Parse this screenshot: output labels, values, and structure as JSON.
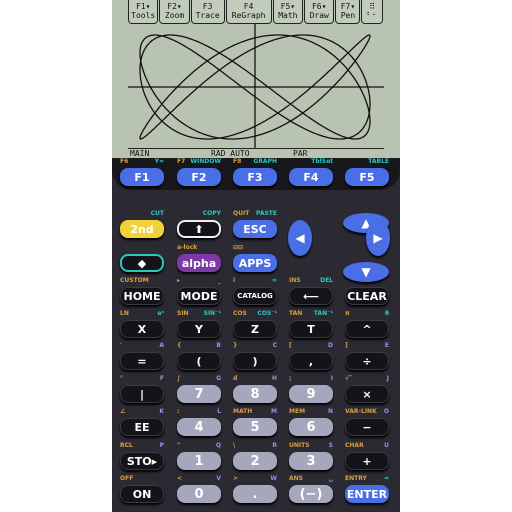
{
  "lcd": {
    "menu": [
      {
        "fn": "F1▾",
        "label": "Tools"
      },
      {
        "fn": "F2▾",
        "label": "Zoom"
      },
      {
        "fn": "F3",
        "label": "Trace"
      },
      {
        "fn": "F4",
        "label": "ReGraph"
      },
      {
        "fn": "F5▾",
        "label": "Math"
      },
      {
        "fn": "F6▾",
        "label": "Draw"
      },
      {
        "fn": "F7▾",
        "label": "Pen"
      },
      {
        "fn": "⠿",
        "label": "⠃⠂"
      }
    ],
    "status": {
      "folder": "MAIN",
      "mode": "RAD AUTO",
      "graph_mode": "PAR"
    }
  },
  "colors": {
    "second": "#d9a040",
    "diamond": "#2cc8c0",
    "alpha": "#a888e8",
    "lcd": "#b8c3b2",
    "body": "#2b2a33"
  },
  "keypad": {
    "fkeys": [
      {
        "label": "F1",
        "tl": "F6",
        "tr": "Y="
      },
      {
        "label": "F2",
        "tl": "F7",
        "tr": "WINDOW"
      },
      {
        "label": "F3",
        "tl": "F8",
        "tr": "GRAPH"
      },
      {
        "label": "F4",
        "tl": "",
        "tr": "TblSet"
      },
      {
        "label": "F5",
        "tl": "",
        "tr": "TABLE"
      }
    ],
    "rows": [
      [
        {
          "label": "2nd",
          "style": "yellow",
          "tl": "",
          "tr": "CUT"
        },
        {
          "label": "⬆",
          "style": "shift",
          "tl": "",
          "tr": "COPY"
        },
        {
          "label": "ESC",
          "style": "blue",
          "tl": "QUIT",
          "tr": "PASTE"
        }
      ],
      [
        {
          "label": "◆",
          "style": "diamond",
          "tl": "",
          "tr": ""
        },
        {
          "label": "alpha",
          "style": "purple",
          "tl": "a-lock",
          "tr": ""
        },
        {
          "label": "APPS",
          "style": "blue",
          "tl": "⊟⊟",
          "tr": ""
        }
      ],
      [
        {
          "label": "HOME",
          "style": "black",
          "tl": "CUSTOM",
          "tr": ""
        },
        {
          "label": "MODE",
          "style": "black",
          "tl": "▸",
          "tr": "_"
        },
        {
          "label": "CATALOG",
          "style": "black",
          "tl": "i",
          "tr": "∞"
        },
        {
          "label": "⟵",
          "style": "black",
          "tl": "INS",
          "tr": "DEL"
        },
        {
          "label": "CLEAR",
          "style": "black",
          "tl": "",
          "tr": ""
        }
      ],
      [
        {
          "label": "X",
          "style": "black",
          "tl": "LN",
          "tr": "eˣ"
        },
        {
          "label": "Y",
          "style": "black",
          "tl": "SIN",
          "tr": "SIN⁻¹"
        },
        {
          "label": "Z",
          "style": "black",
          "tl": "COS",
          "tr": "COS⁻¹"
        },
        {
          "label": "T",
          "style": "black",
          "tl": "TAN",
          "tr": "TAN⁻¹"
        },
        {
          "label": "^",
          "style": "black",
          "tl": "π",
          "tr": "θ"
        }
      ],
      [
        {
          "label": "=",
          "style": "black",
          "tl": "'",
          "tr": "A"
        },
        {
          "label": "(",
          "style": "black",
          "tl": "{",
          "tr": "B"
        },
        {
          "label": ")",
          "style": "black",
          "tl": "}",
          "tr": "C"
        },
        {
          "label": ",",
          "style": "black",
          "tl": "[",
          "tr": "D"
        },
        {
          "label": "÷",
          "style": "black",
          "tl": "]",
          "tr": "E"
        }
      ],
      [
        {
          "label": "|",
          "style": "black",
          "tl": "°",
          "tr": "F"
        },
        {
          "label": "7",
          "style": "gray",
          "tl": "∫",
          "tr": "G"
        },
        {
          "label": "8",
          "style": "gray",
          "tl": "d",
          "tr": "H"
        },
        {
          "label": "9",
          "style": "gray",
          "tl": ";",
          "tr": "I"
        },
        {
          "label": "×",
          "style": "black",
          "tl": "√‾",
          "tr": "J"
        }
      ],
      [
        {
          "label": "EE",
          "style": "black",
          "tl": "∠",
          "tr": "K"
        },
        {
          "label": "4",
          "style": "gray",
          "tl": ":",
          "tr": "L"
        },
        {
          "label": "5",
          "style": "gray",
          "tl": "MATH",
          "tr": "M"
        },
        {
          "label": "6",
          "style": "gray",
          "tl": "MEM",
          "tr": "N"
        },
        {
          "label": "−",
          "style": "black",
          "tl": "VAR-LINK",
          "tr": "O"
        }
      ],
      [
        {
          "label": "STO▸",
          "style": "black",
          "tl": "RCL",
          "tr": "P"
        },
        {
          "label": "1",
          "style": "gray",
          "tl": "\"",
          "tr": "Q"
        },
        {
          "label": "2",
          "style": "gray",
          "tl": "\\",
          "tr": "R"
        },
        {
          "label": "3",
          "style": "gray",
          "tl": "UNITS",
          "tr": "S"
        },
        {
          "label": "+",
          "style": "black",
          "tl": "CHAR",
          "tr": "U"
        }
      ],
      [
        {
          "label": "ON",
          "style": "black",
          "tl": "OFF",
          "tr": ""
        },
        {
          "label": "0",
          "style": "gray",
          "tl": "<",
          "tr": "V"
        },
        {
          "label": ".",
          "style": "gray",
          "tl": ">",
          "tr": "W"
        },
        {
          "label": "(−)",
          "style": "gray",
          "tl": "ANS",
          "tr": "␣"
        },
        {
          "label": "ENTER",
          "style": "blue",
          "tl": "ENTRY",
          "tr": "≈"
        }
      ]
    ],
    "arrows": [
      {
        "dir": "up",
        "glyph": "▲"
      },
      {
        "dir": "down",
        "glyph": "▼"
      },
      {
        "dir": "left",
        "glyph": "◀"
      },
      {
        "dir": "right",
        "glyph": "▶"
      }
    ]
  }
}
